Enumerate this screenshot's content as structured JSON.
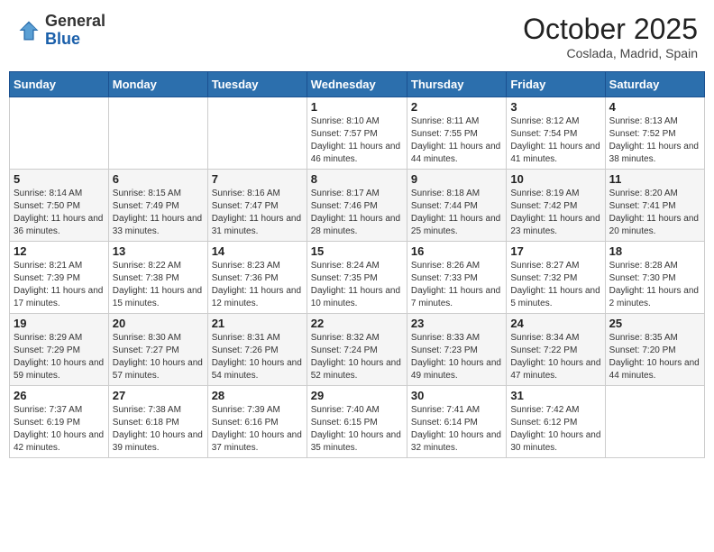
{
  "header": {
    "logo_general": "General",
    "logo_blue": "Blue",
    "month": "October 2025",
    "location": "Coslada, Madrid, Spain"
  },
  "days_of_week": [
    "Sunday",
    "Monday",
    "Tuesday",
    "Wednesday",
    "Thursday",
    "Friday",
    "Saturday"
  ],
  "weeks": [
    [
      {
        "day": "",
        "info": ""
      },
      {
        "day": "",
        "info": ""
      },
      {
        "day": "",
        "info": ""
      },
      {
        "day": "1",
        "info": "Sunrise: 8:10 AM\nSunset: 7:57 PM\nDaylight: 11 hours and 46 minutes."
      },
      {
        "day": "2",
        "info": "Sunrise: 8:11 AM\nSunset: 7:55 PM\nDaylight: 11 hours and 44 minutes."
      },
      {
        "day": "3",
        "info": "Sunrise: 8:12 AM\nSunset: 7:54 PM\nDaylight: 11 hours and 41 minutes."
      },
      {
        "day": "4",
        "info": "Sunrise: 8:13 AM\nSunset: 7:52 PM\nDaylight: 11 hours and 38 minutes."
      }
    ],
    [
      {
        "day": "5",
        "info": "Sunrise: 8:14 AM\nSunset: 7:50 PM\nDaylight: 11 hours and 36 minutes."
      },
      {
        "day": "6",
        "info": "Sunrise: 8:15 AM\nSunset: 7:49 PM\nDaylight: 11 hours and 33 minutes."
      },
      {
        "day": "7",
        "info": "Sunrise: 8:16 AM\nSunset: 7:47 PM\nDaylight: 11 hours and 31 minutes."
      },
      {
        "day": "8",
        "info": "Sunrise: 8:17 AM\nSunset: 7:46 PM\nDaylight: 11 hours and 28 minutes."
      },
      {
        "day": "9",
        "info": "Sunrise: 8:18 AM\nSunset: 7:44 PM\nDaylight: 11 hours and 25 minutes."
      },
      {
        "day": "10",
        "info": "Sunrise: 8:19 AM\nSunset: 7:42 PM\nDaylight: 11 hours and 23 minutes."
      },
      {
        "day": "11",
        "info": "Sunrise: 8:20 AM\nSunset: 7:41 PM\nDaylight: 11 hours and 20 minutes."
      }
    ],
    [
      {
        "day": "12",
        "info": "Sunrise: 8:21 AM\nSunset: 7:39 PM\nDaylight: 11 hours and 17 minutes."
      },
      {
        "day": "13",
        "info": "Sunrise: 8:22 AM\nSunset: 7:38 PM\nDaylight: 11 hours and 15 minutes."
      },
      {
        "day": "14",
        "info": "Sunrise: 8:23 AM\nSunset: 7:36 PM\nDaylight: 11 hours and 12 minutes."
      },
      {
        "day": "15",
        "info": "Sunrise: 8:24 AM\nSunset: 7:35 PM\nDaylight: 11 hours and 10 minutes."
      },
      {
        "day": "16",
        "info": "Sunrise: 8:26 AM\nSunset: 7:33 PM\nDaylight: 11 hours and 7 minutes."
      },
      {
        "day": "17",
        "info": "Sunrise: 8:27 AM\nSunset: 7:32 PM\nDaylight: 11 hours and 5 minutes."
      },
      {
        "day": "18",
        "info": "Sunrise: 8:28 AM\nSunset: 7:30 PM\nDaylight: 11 hours and 2 minutes."
      }
    ],
    [
      {
        "day": "19",
        "info": "Sunrise: 8:29 AM\nSunset: 7:29 PM\nDaylight: 10 hours and 59 minutes."
      },
      {
        "day": "20",
        "info": "Sunrise: 8:30 AM\nSunset: 7:27 PM\nDaylight: 10 hours and 57 minutes."
      },
      {
        "day": "21",
        "info": "Sunrise: 8:31 AM\nSunset: 7:26 PM\nDaylight: 10 hours and 54 minutes."
      },
      {
        "day": "22",
        "info": "Sunrise: 8:32 AM\nSunset: 7:24 PM\nDaylight: 10 hours and 52 minutes."
      },
      {
        "day": "23",
        "info": "Sunrise: 8:33 AM\nSunset: 7:23 PM\nDaylight: 10 hours and 49 minutes."
      },
      {
        "day": "24",
        "info": "Sunrise: 8:34 AM\nSunset: 7:22 PM\nDaylight: 10 hours and 47 minutes."
      },
      {
        "day": "25",
        "info": "Sunrise: 8:35 AM\nSunset: 7:20 PM\nDaylight: 10 hours and 44 minutes."
      }
    ],
    [
      {
        "day": "26",
        "info": "Sunrise: 7:37 AM\nSunset: 6:19 PM\nDaylight: 10 hours and 42 minutes."
      },
      {
        "day": "27",
        "info": "Sunrise: 7:38 AM\nSunset: 6:18 PM\nDaylight: 10 hours and 39 minutes."
      },
      {
        "day": "28",
        "info": "Sunrise: 7:39 AM\nSunset: 6:16 PM\nDaylight: 10 hours and 37 minutes."
      },
      {
        "day": "29",
        "info": "Sunrise: 7:40 AM\nSunset: 6:15 PM\nDaylight: 10 hours and 35 minutes."
      },
      {
        "day": "30",
        "info": "Sunrise: 7:41 AM\nSunset: 6:14 PM\nDaylight: 10 hours and 32 minutes."
      },
      {
        "day": "31",
        "info": "Sunrise: 7:42 AM\nSunset: 6:12 PM\nDaylight: 10 hours and 30 minutes."
      },
      {
        "day": "",
        "info": ""
      }
    ]
  ]
}
